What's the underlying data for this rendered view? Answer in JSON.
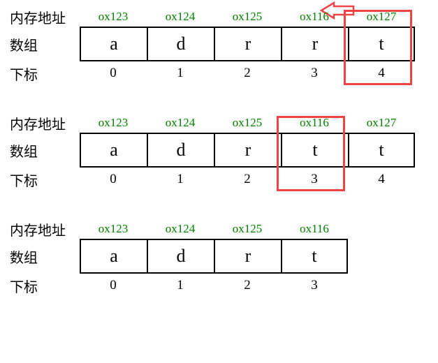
{
  "labels": {
    "addr": "内存地址",
    "array": "数组",
    "index": "下标"
  },
  "chart_data": [
    {
      "type": "table",
      "title": "Array memory layout — step 1",
      "addresses": [
        "ox123",
        "ox124",
        "ox125",
        "ox116",
        "ox127"
      ],
      "values": [
        "a",
        "d",
        "r",
        "r",
        "t"
      ],
      "indices": [
        "0",
        "1",
        "2",
        "3",
        "4"
      ],
      "highlight_index": 4,
      "arrow": true
    },
    {
      "type": "table",
      "title": "Array memory layout — step 2",
      "addresses": [
        "ox123",
        "ox124",
        "ox125",
        "ox116",
        "ox127"
      ],
      "values": [
        "a",
        "d",
        "r",
        "t",
        "t"
      ],
      "indices": [
        "0",
        "1",
        "2",
        "3",
        "4"
      ],
      "highlight_index": 3,
      "arrow": false
    },
    {
      "type": "table",
      "title": "Array memory layout — step 3",
      "addresses": [
        "ox123",
        "ox124",
        "ox125",
        "ox116"
      ],
      "values": [
        "a",
        "d",
        "r",
        "t"
      ],
      "indices": [
        "0",
        "1",
        "2",
        "3"
      ],
      "highlight_index": null,
      "arrow": false
    }
  ]
}
